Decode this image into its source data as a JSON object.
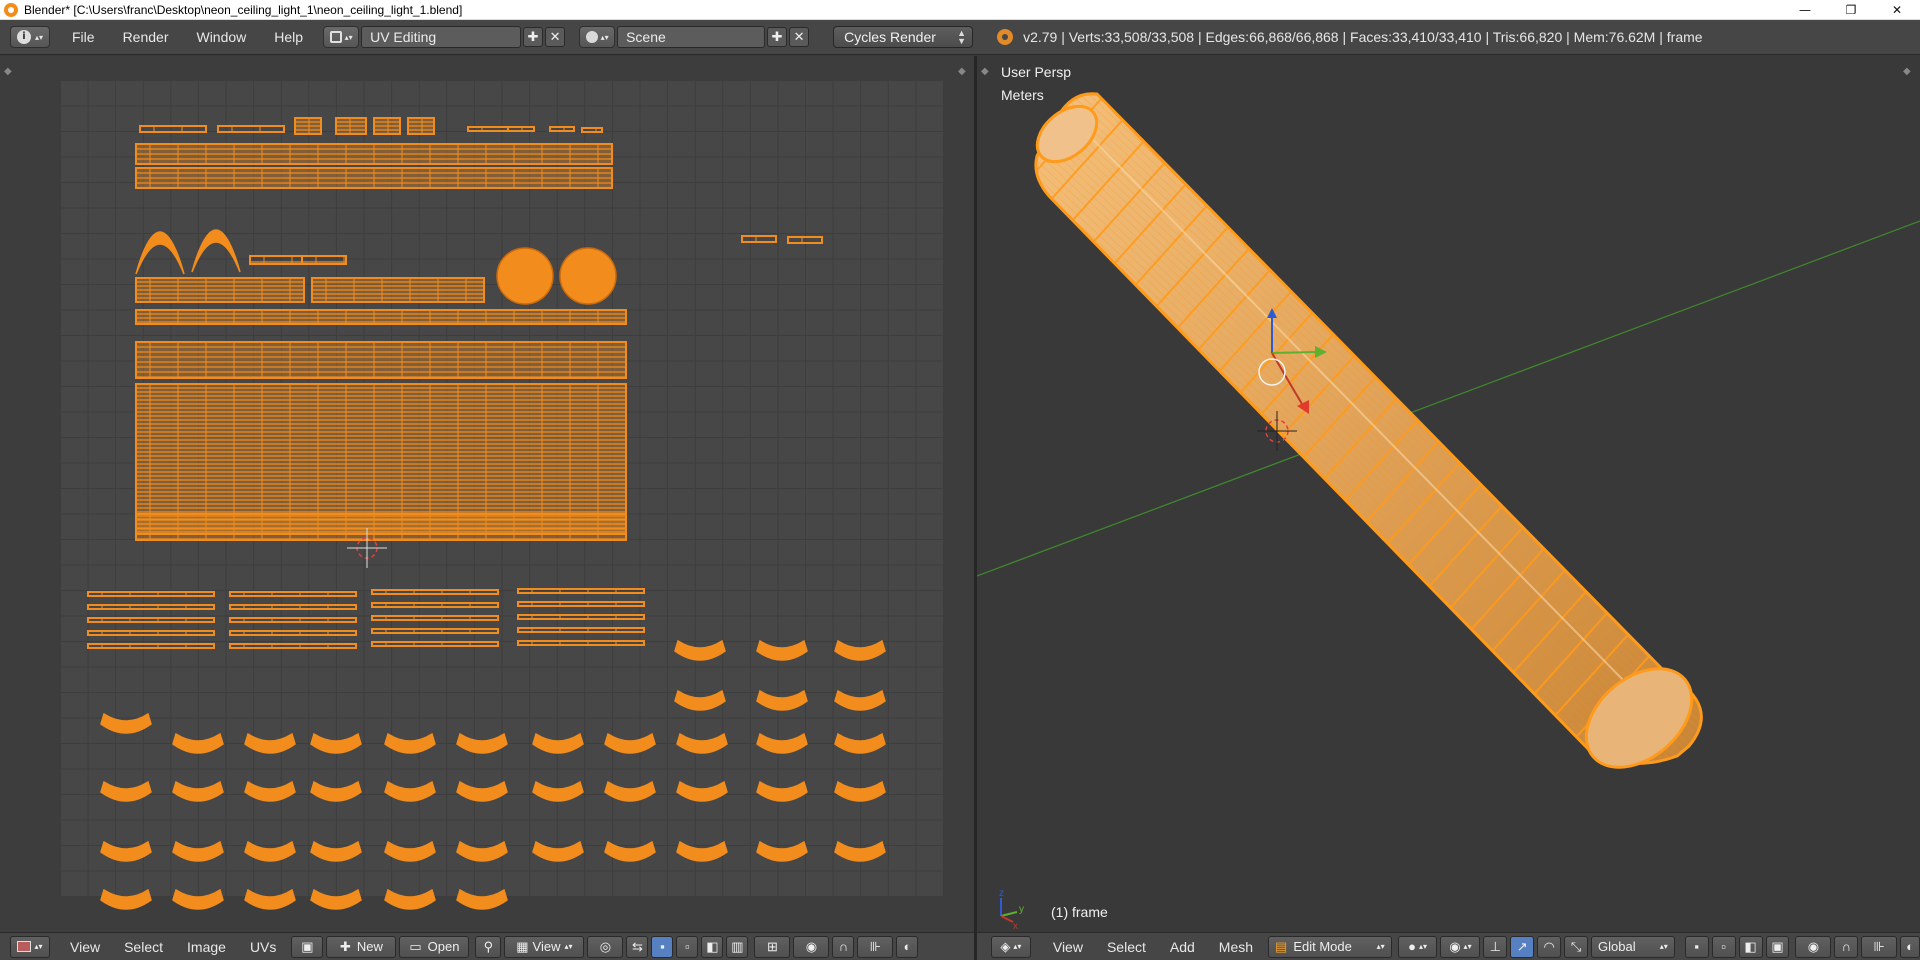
{
  "window": {
    "title": "Blender* [C:\\Users\\franc\\Desktop\\neon_ceiling_light_1\\neon_ceiling_light_1.blend]",
    "controls": [
      "—",
      "❐",
      "✕"
    ]
  },
  "info_header": {
    "menus": [
      "File",
      "Render",
      "Window",
      "Help"
    ],
    "screen_layout": "UV Editing",
    "scene": "Scene",
    "render_engine": "Cycles Render",
    "stats": "v2.79 | Verts:33,508/33,508 | Edges:66,868/66,868 | Faces:33,410/33,410 | Tris:66,820 | Mem:76.62M | frame"
  },
  "uv_editor": {
    "menus": [
      "View",
      "Select",
      "Image",
      "UVs"
    ],
    "new_button": "New",
    "open_button": "Open",
    "view_dropdown": "View"
  },
  "viewport": {
    "view_name": "User Persp",
    "units": "Meters",
    "object_label": "(1) frame",
    "menus": [
      "View",
      "Select",
      "Add",
      "Mesh"
    ],
    "mode": "Edit Mode",
    "orientation": "Global"
  },
  "colors": {
    "uv_wire": "#f28c1c",
    "header_bg": "#464646",
    "editor_bg": "#393939",
    "x_axis": "#c0392b",
    "y_axis": "#5fb030",
    "z_axis": "#2d5bd1"
  },
  "icons": [
    "blender-icon",
    "info-icon",
    "screen-layout-icon",
    "scene-icon",
    "cycles-icon",
    "editor-type-icon",
    "3d-cursor-icon",
    "manipulator-icon"
  ]
}
